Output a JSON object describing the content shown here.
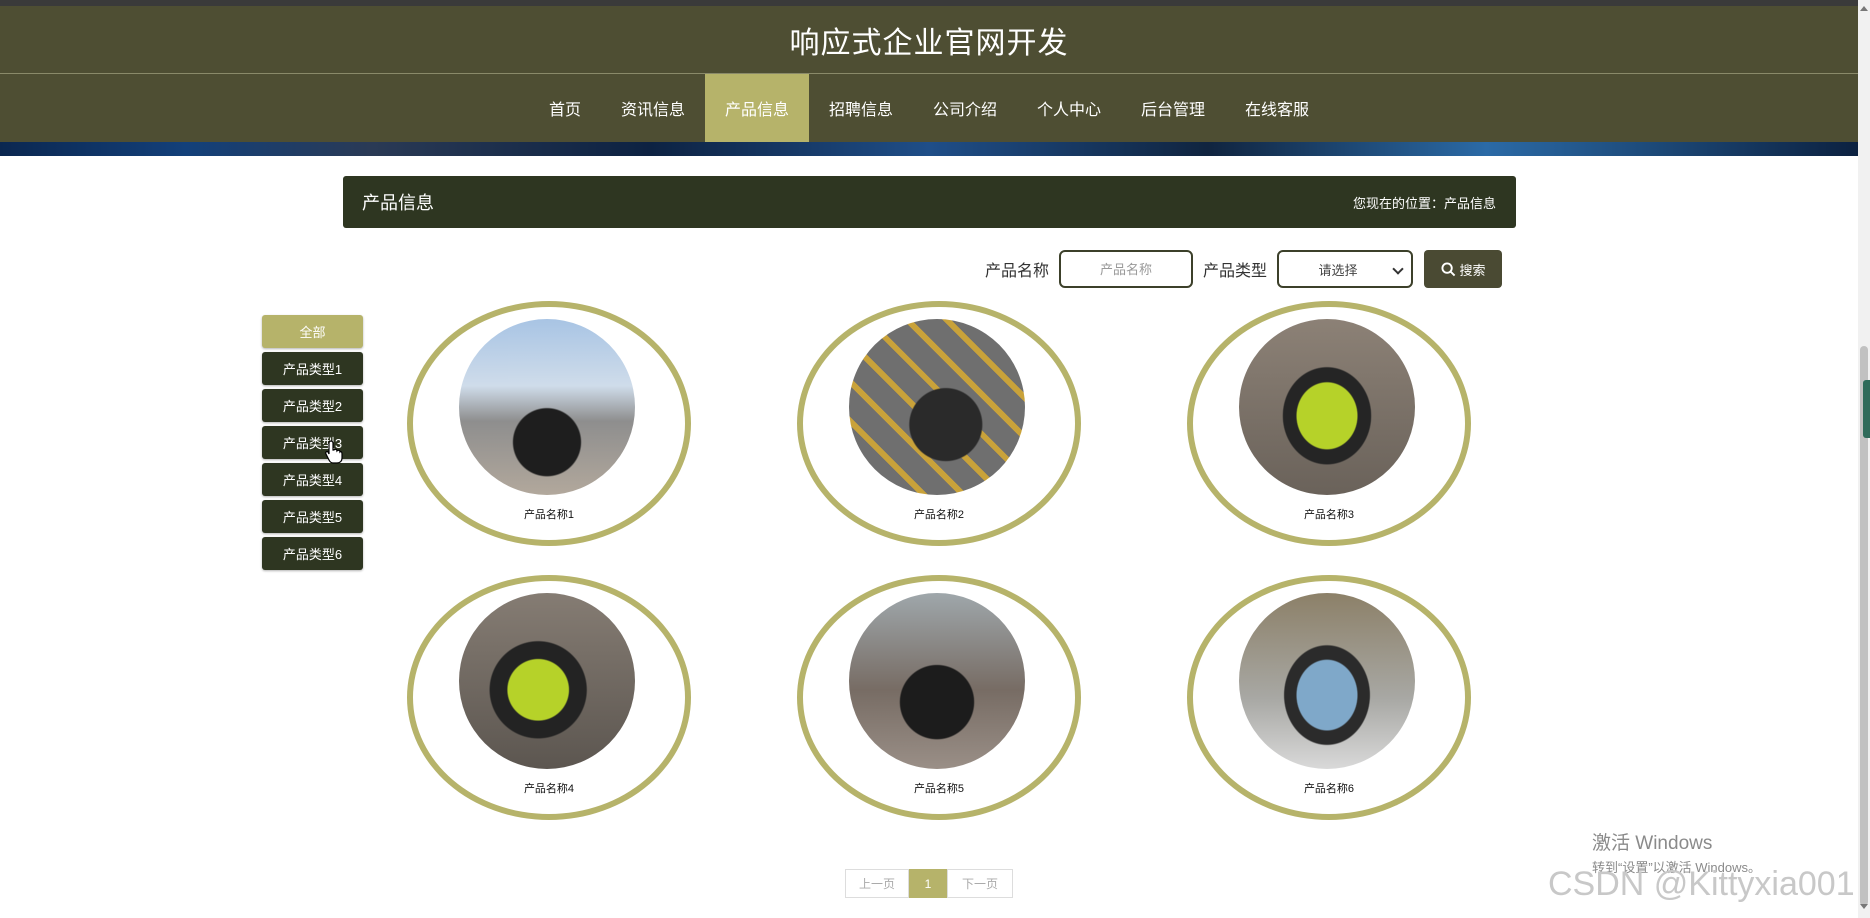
{
  "site": {
    "title": "响应式企业官网开发"
  },
  "nav": {
    "items": [
      {
        "label": "首页"
      },
      {
        "label": "资讯信息"
      },
      {
        "label": "产品信息"
      },
      {
        "label": "招聘信息"
      },
      {
        "label": "公司介绍"
      },
      {
        "label": "个人中心"
      },
      {
        "label": "后台管理"
      },
      {
        "label": "在线客服"
      }
    ],
    "active_index": 2
  },
  "section": {
    "title": "产品信息",
    "breadcrumb": "您现在的位置：产品信息"
  },
  "search": {
    "name_label": "产品名称",
    "name_placeholder": "产品名称",
    "type_label": "产品类型",
    "type_selected": "请选择",
    "button_label": "搜索"
  },
  "categories": [
    {
      "label": "全部"
    },
    {
      "label": "产品类型1"
    },
    {
      "label": "产品类型2"
    },
    {
      "label": "产品类型3"
    },
    {
      "label": "产品类型4"
    },
    {
      "label": "产品类型5"
    },
    {
      "label": "产品类型6"
    }
  ],
  "products": [
    {
      "name": "产品名称1"
    },
    {
      "name": "产品名称2"
    },
    {
      "name": "产品名称3"
    },
    {
      "name": "产品名称4"
    },
    {
      "name": "产品名称5"
    },
    {
      "name": "产品名称6"
    }
  ],
  "pagination": {
    "prev": "上一页",
    "current": "1",
    "next": "下一页"
  },
  "overlays": {
    "windows_line1": "激活 Windows",
    "windows_line2": "转到“设置”以激活 Windows。",
    "csdn": "CSDN @Kittyxia001"
  },
  "colors": {
    "header": "#4e4e33",
    "accent": "#b6b36a",
    "dark": "#2e3621"
  }
}
